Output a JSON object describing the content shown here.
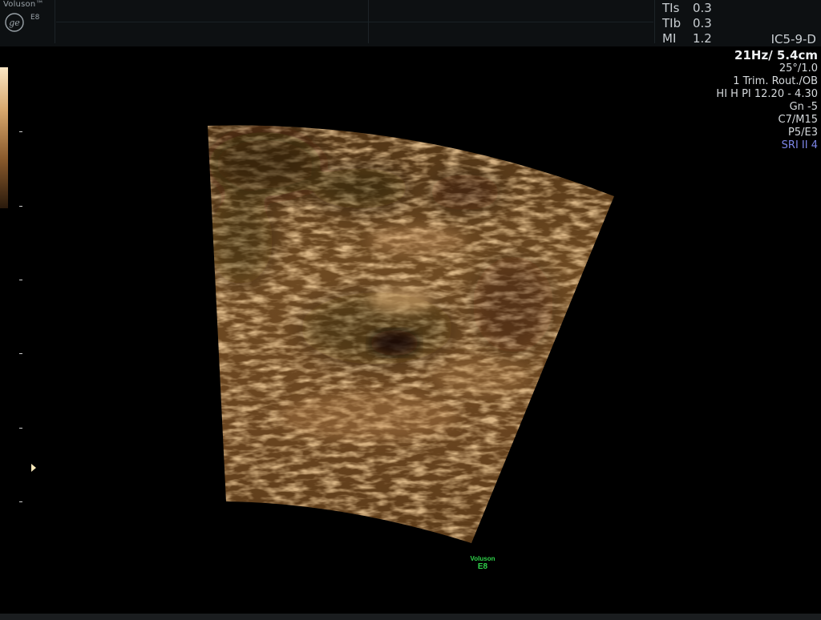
{
  "header": {
    "brand": "Voluson™",
    "model": "E8",
    "logo": "ge-logo-icon",
    "indices": [
      {
        "label": "TIs",
        "value": "0.3"
      },
      {
        "label": "TIb",
        "value": "0.3"
      },
      {
        "label": "MI",
        "value": "1.2"
      }
    ],
    "probe": "IC5-9-D"
  },
  "info_panel": {
    "frame_depth": "21Hz/ 5.4cm",
    "angle": "25°/1.0",
    "preset": "1 Trim. Rout./OB",
    "harmonic": "HI H PI 12.20 - 4.30",
    "gain": "Gn -5",
    "contrast": "C7/M15",
    "persistence": "P5/E3",
    "sri": "SRI II 4"
  },
  "watermark": {
    "brand": "Voluson",
    "model": "E8"
  },
  "colors": {
    "tint_light": "#d9a86a",
    "tint_dark": "#3a220c",
    "sri_text": "#7d86e8",
    "watermark": "#2fd24a"
  }
}
